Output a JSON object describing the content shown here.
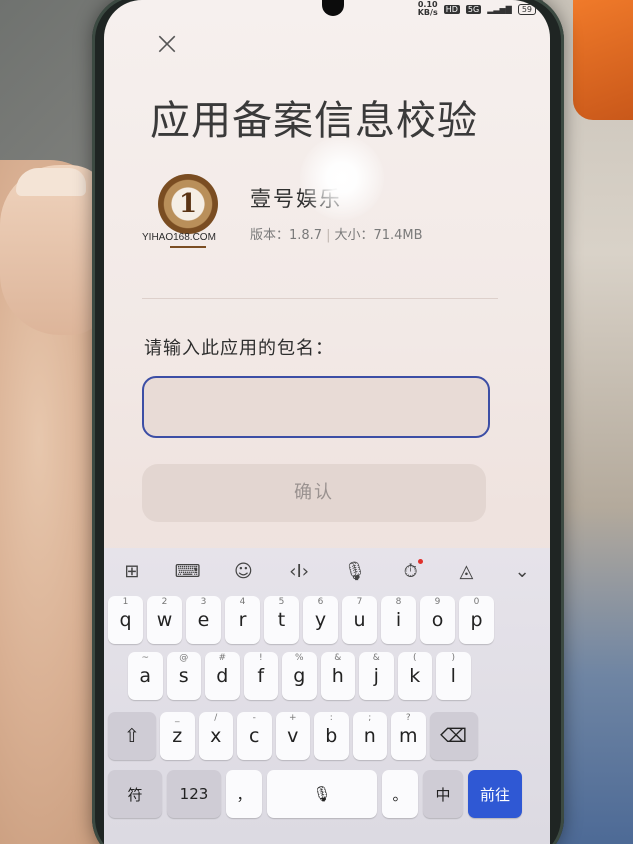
{
  "status_bar": {
    "speed": "0.10",
    "speed_unit": "KB/s",
    "hd": "HD",
    "network": "5G",
    "battery": "59"
  },
  "dialog": {
    "close_icon": "close-icon",
    "title": "应用备案信息校验",
    "app": {
      "logo_text": "YIHAO168.COM",
      "logo_glyph": "1",
      "name": "壹号娱乐",
      "version": "版本：1.8.7",
      "size": "大小：71.4MB"
    },
    "prompt": "请输入此应用的包名：",
    "input_value": "",
    "confirm_label": "确认"
  },
  "keyboard": {
    "toolbar": [
      "grid-icon",
      "keyboard-icon",
      "emoji-icon",
      "cursor-icon",
      "mic-icon",
      "record-icon",
      "handwriting-icon",
      "collapse-icon"
    ],
    "row1": [
      {
        "key": "q",
        "sub": "1"
      },
      {
        "key": "w",
        "sub": "2"
      },
      {
        "key": "e",
        "sub": "3"
      },
      {
        "key": "r",
        "sub": "4"
      },
      {
        "key": "t",
        "sub": "5"
      },
      {
        "key": "y",
        "sub": "6"
      },
      {
        "key": "u",
        "sub": "7"
      },
      {
        "key": "i",
        "sub": "8"
      },
      {
        "key": "o",
        "sub": "9"
      },
      {
        "key": "p",
        "sub": "0"
      }
    ],
    "row2": [
      {
        "key": "a",
        "sub": "~"
      },
      {
        "key": "s",
        "sub": "@"
      },
      {
        "key": "d",
        "sub": "#"
      },
      {
        "key": "f",
        "sub": "!"
      },
      {
        "key": "g",
        "sub": "%"
      },
      {
        "key": "h",
        "sub": "&"
      },
      {
        "key": "j",
        "sub": "&"
      },
      {
        "key": "k",
        "sub": "("
      },
      {
        "key": "l",
        "sub": ")"
      }
    ],
    "row3": [
      {
        "key": "z",
        "sub": "_"
      },
      {
        "key": "x",
        "sub": "/"
      },
      {
        "key": "c",
        "sub": "-"
      },
      {
        "key": "v",
        "sub": "+"
      },
      {
        "key": "b",
        "sub": ":"
      },
      {
        "key": "n",
        "sub": ";"
      },
      {
        "key": "m",
        "sub": "?"
      }
    ],
    "shift_glyph": "⇧",
    "backspace_glyph": "⌫",
    "symbols_label": "符",
    "numbers_label": "123",
    "comma": "，",
    "space_glyph": "🎙",
    "period": "。",
    "lang_label": "中",
    "go_label": "前往"
  }
}
